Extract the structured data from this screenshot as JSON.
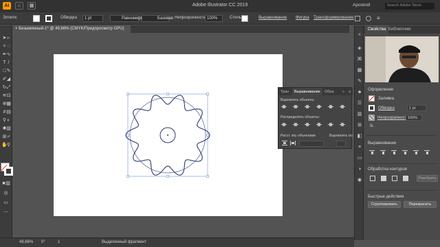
{
  "titlebar": {
    "title": "Adobe Illustrator CC 2019",
    "app_icon": "Ai",
    "home_icon": "home-icon",
    "grid_icon": "▦",
    "user": "Apostroll",
    "search_placeholder": "Search Adobe Stock"
  },
  "controlbar": {
    "selection_label": "Эллипс",
    "stroke_label": "Обводка",
    "stroke_weight": "1 pt",
    "profile_label": "Равномерно",
    "brush_label": "Базовая",
    "opacity_label": "Непрозрачность",
    "opacity_value": "100%",
    "style_label": "Стиль",
    "align_link": "Выравнивание",
    "shape_link": "Фигура",
    "transform_link": "Трансформирование"
  },
  "document_tab": {
    "label": "Безымянный-1* @ 49,66% (CMYK/Предпросмотр GPU)"
  },
  "align_panel": {
    "tabs": [
      "Тран",
      "Выравнивание",
      "Обра"
    ],
    "active_tab": "Выравнивание",
    "align_objects_label": "Выровнять объекты:",
    "distribute_objects_label": "Распределить объекты:",
    "distribute_spacing_label": "Расст. м/у объектами",
    "align_to_label": "Выровнять по:"
  },
  "right_panel": {
    "tabs": [
      "Свойства",
      "Библиотеки"
    ],
    "active_tab": "Свойства",
    "appearance_title": "Оформление",
    "fill_label": "Заливка",
    "stroke_label": "Обводка",
    "stroke_value": "1 pt",
    "opacity_label": "Непрозрачность",
    "opacity_value": "100%",
    "fx_label": "fx.",
    "align_title": "Выравнивание",
    "pathfinder_title": "Обработка контуров",
    "expand_button": "Разобрать",
    "quick_actions_title": "Быстрые действия",
    "group_button": "Сгруппировать",
    "recolor_button": "Перекрасить"
  },
  "statusbar": {
    "zoom": "49,66%",
    "rotation": "0°",
    "artboard": "1",
    "status_text": "Выделенный фрагмент"
  },
  "colors": {
    "accent": "#ff9a00",
    "shape_stroke": "#2a3a6e",
    "bbox": "#6f8fd6"
  }
}
